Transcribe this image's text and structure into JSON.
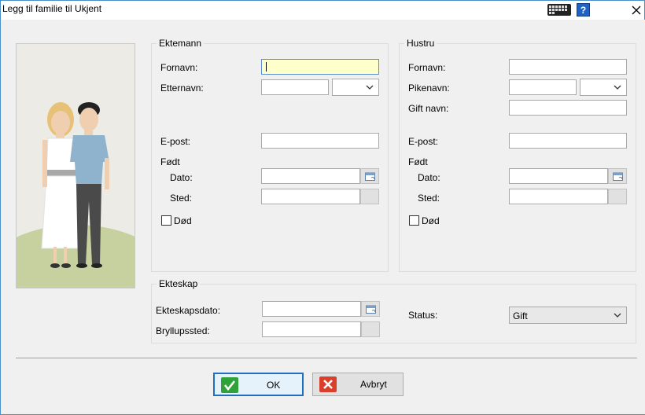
{
  "window": {
    "title": "Legg til familie til Ukjent",
    "help_label": "?"
  },
  "husband": {
    "group_title": "Ektemann",
    "firstname_label": "Fornavn:",
    "firstname_value": "",
    "lastname_label": "Etternavn:",
    "lastname_value": "",
    "email_label": "E-post:",
    "born_label": "Født",
    "date_label": "Dato:",
    "place_label": "Sted:",
    "dead_label": "Død"
  },
  "wife": {
    "group_title": "Hustru",
    "firstname_label": "Fornavn:",
    "maidenname_label": "Pikenavn:",
    "marriedname_label": "Gift navn:",
    "email_label": "E-post:",
    "born_label": "Født",
    "date_label": "Dato:",
    "place_label": "Sted:",
    "dead_label": "Død"
  },
  "marriage": {
    "group_title": "Ekteskap",
    "date_label": "Ekteskapsdato:",
    "place_label": "Bryllupssted:",
    "status_label": "Status:",
    "status_value": "Gift"
  },
  "buttons": {
    "ok_label": "OK",
    "cancel_label": "Avbryt"
  },
  "colors": {
    "focus_field": "#ffffcc",
    "ok_icon": "#2fa33a",
    "cancel_icon": "#d9402c"
  },
  "icons": {
    "keyboard": "keyboard-icon",
    "help": "help-icon",
    "close": "close-icon",
    "calendar": "calendar-icon",
    "dropdown": "chevron-down-icon",
    "ok": "checkmark-icon",
    "cancel": "x-mark-icon"
  }
}
